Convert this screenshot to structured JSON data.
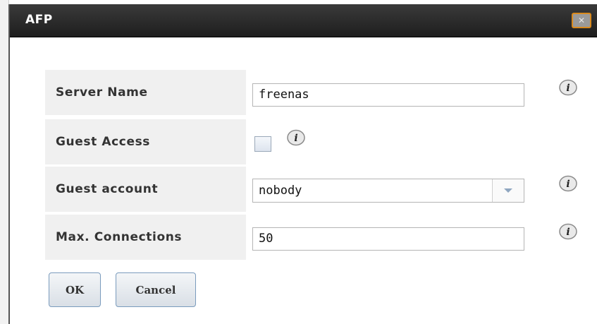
{
  "dialog": {
    "title": "AFP",
    "close_icon": "close-icon"
  },
  "fields": {
    "server_name": {
      "label": "Server Name",
      "value": "freenas"
    },
    "guest_access": {
      "label": "Guest Access",
      "checked": false
    },
    "guest_account": {
      "label": "Guest account",
      "selected": "nobody"
    },
    "max_connections": {
      "label": "Max. Connections",
      "value": "50"
    }
  },
  "buttons": {
    "ok_label": "OK",
    "cancel_label": "Cancel"
  },
  "icons": {
    "help": "info-icon",
    "dropdown": "chevron-down-icon"
  },
  "colors": {
    "titlebar": "#2a2a2a",
    "close_border": "#d98a1e",
    "label_bg": "#f0f0f0",
    "button_border": "#7a9bbd"
  }
}
